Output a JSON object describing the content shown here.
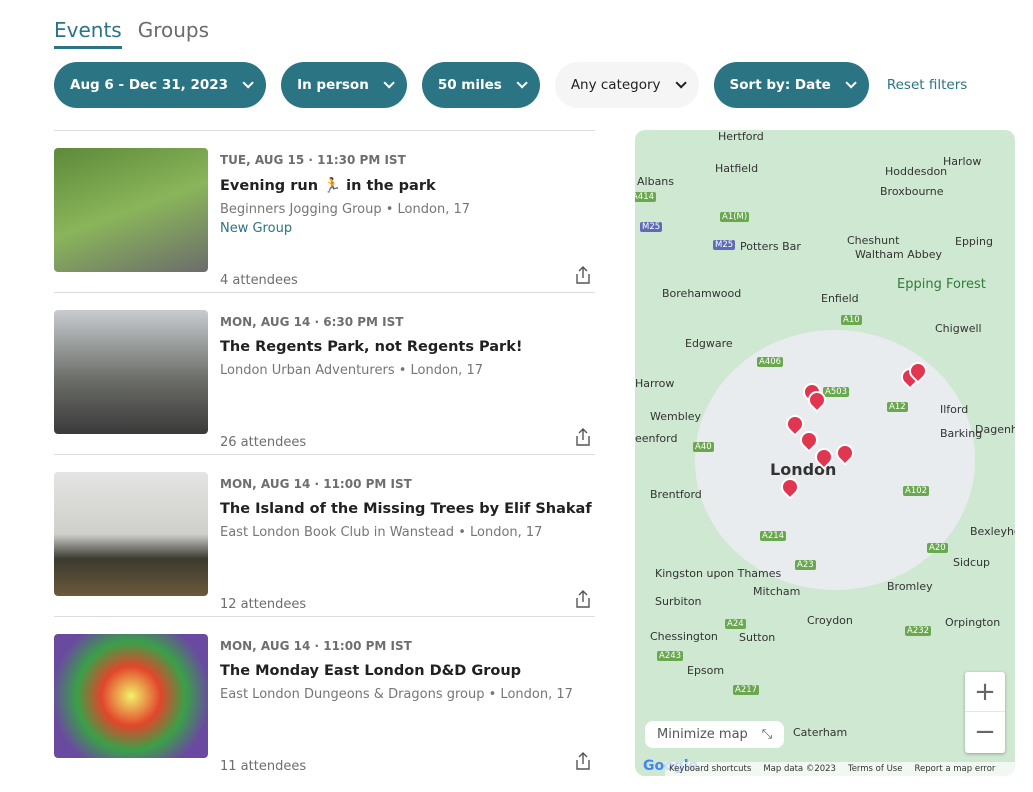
{
  "tabs": [
    {
      "label": "Events",
      "active": true
    },
    {
      "label": "Groups",
      "active": false
    }
  ],
  "filters": {
    "date": "Aug 6 - Dec 31, 2023",
    "type": "In person",
    "distance": "50 miles",
    "category": "Any category",
    "sort": "Sort by: Date",
    "reset": "Reset filters"
  },
  "events": [
    {
      "date": "TUE, AUG 15 · 11:30 PM IST",
      "title": "Evening run 🏃 in the park",
      "group": "Beginners Jogging Group • London, 17",
      "badge": "New Group",
      "attendees": "4 attendees"
    },
    {
      "date": "MON, AUG 14 · 6:30 PM IST",
      "title": "The Regents Park, not Regents Park!",
      "group": "London Urban Adventurers • London, 17",
      "attendees": "26 attendees"
    },
    {
      "date": "MON, AUG 14 · 11:00 PM IST",
      "title": "The Island of the Missing Trees by Elif Shakaf",
      "group": "East London Book Club in Wanstead • London, 17",
      "attendees": "12 attendees"
    },
    {
      "date": "MON, AUG 14 · 11:00 PM IST",
      "title": "The Monday East London D&D Group",
      "group": "East London Dungeons & Dragons group • London, 17",
      "attendees": "11 attendees"
    }
  ],
  "map": {
    "places": [
      "Hertford",
      "Hatfield",
      "Hoddesdon",
      "Harlow",
      "Albans",
      "Broxbourne",
      "Potters Bar",
      "Cheshunt",
      "Waltham Abbey",
      "Epping",
      "Epping Forest",
      "Borehamwood",
      "Enfield",
      "Chigwell",
      "Edgware",
      "Harrow",
      "Wembley",
      "Ilford",
      "Barking",
      "Dagenham",
      "eenford",
      "London",
      "Brentford",
      "Bexleyheath",
      "Kingston upon Thames",
      "Surbiton",
      "Mitcham",
      "Croydon",
      "Bromley",
      "Sidcup",
      "Orpington",
      "Chessington",
      "Sutton",
      "Epsom",
      "Caterham"
    ],
    "roads": [
      "A414",
      "A1(M)",
      "M25",
      "A10",
      "A406",
      "A503",
      "A12",
      "A40",
      "A102",
      "A214",
      "A23",
      "A20",
      "A24",
      "A232",
      "A243",
      "A217",
      "M25"
    ],
    "minimize": "Minimize map",
    "zoom_in": "+",
    "zoom_out": "−",
    "logo": "Google",
    "attribution": [
      "Keyboard shortcuts",
      "Map data ©2023",
      "Terms of Use",
      "Report a map error"
    ],
    "pin_color": "#e0364f"
  },
  "colors": {
    "accent": "#2b7484"
  }
}
